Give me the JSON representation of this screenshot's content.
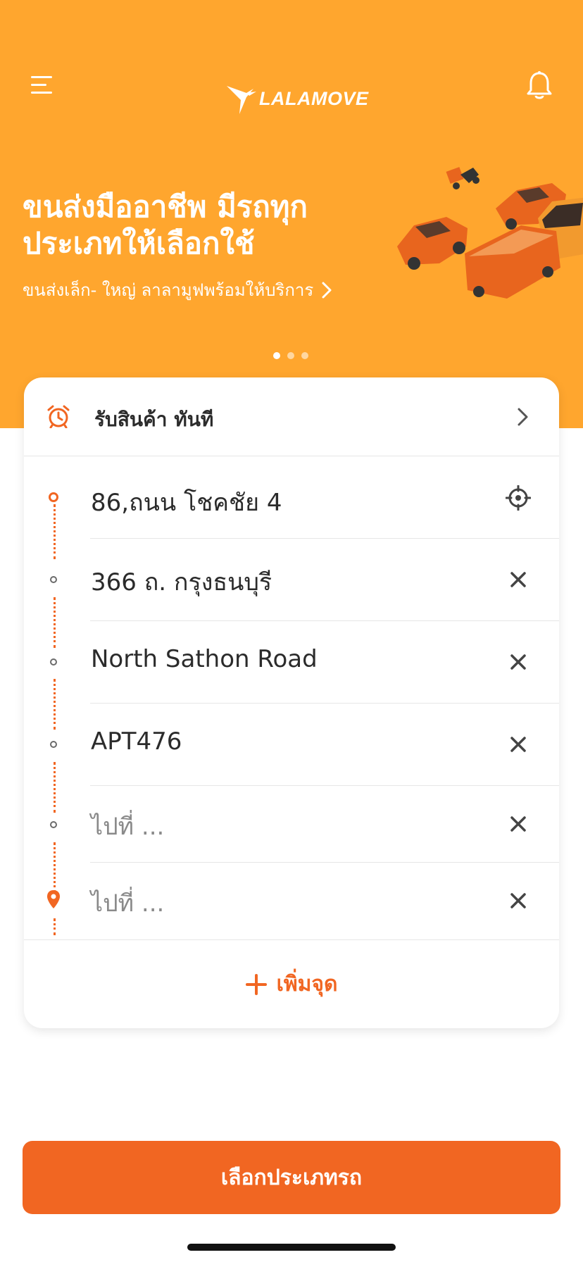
{
  "header": {
    "menu_icon": "hamburger-menu-icon",
    "logo_text": "LALAMOVE",
    "bell_icon": "bell-icon"
  },
  "banner": {
    "title_line1": "ขนส่งมืออาชีพ มีรถทุก",
    "title_line2": "ประเภทให้เลือกใช้",
    "subtitle": "ขนส่งเล็ก- ใหญ่ ลาลามูฟพร้อมให้บริการ",
    "subtitle_icon": "chevron-right-icon",
    "pages": 3,
    "active_page": 1
  },
  "order_card": {
    "pickup_time": {
      "icon": "alarm-clock-icon",
      "label": "รับสินค้า ทันที"
    },
    "stops": [
      {
        "text": "86,ถนน โชคชัย 4",
        "is_placeholder": false,
        "action_icon": "locate-crosshair-icon"
      },
      {
        "text": "366 ถ. กรุงธนบุรี",
        "is_placeholder": false,
        "action_icon": "close-icon"
      },
      {
        "text": "North Sathon Road",
        "is_placeholder": false,
        "action_icon": "close-icon"
      },
      {
        "text": "APT476",
        "is_placeholder": false,
        "action_icon": "close-icon"
      },
      {
        "text": "ไปที่ ...",
        "is_placeholder": true,
        "action_icon": "close-icon"
      },
      {
        "text": "ไปที่ ...",
        "is_placeholder": true,
        "action_icon": "close-icon"
      }
    ],
    "add_stop_label": "เพิ่มจุด"
  },
  "primary_button": {
    "label": "เลือกประเภทรถ"
  },
  "colors": {
    "brand_orange": "#F16622",
    "banner_orange": "#FFA62E",
    "text_dark": "#2b2b2b",
    "placeholder_gray": "#8a8a8a"
  }
}
